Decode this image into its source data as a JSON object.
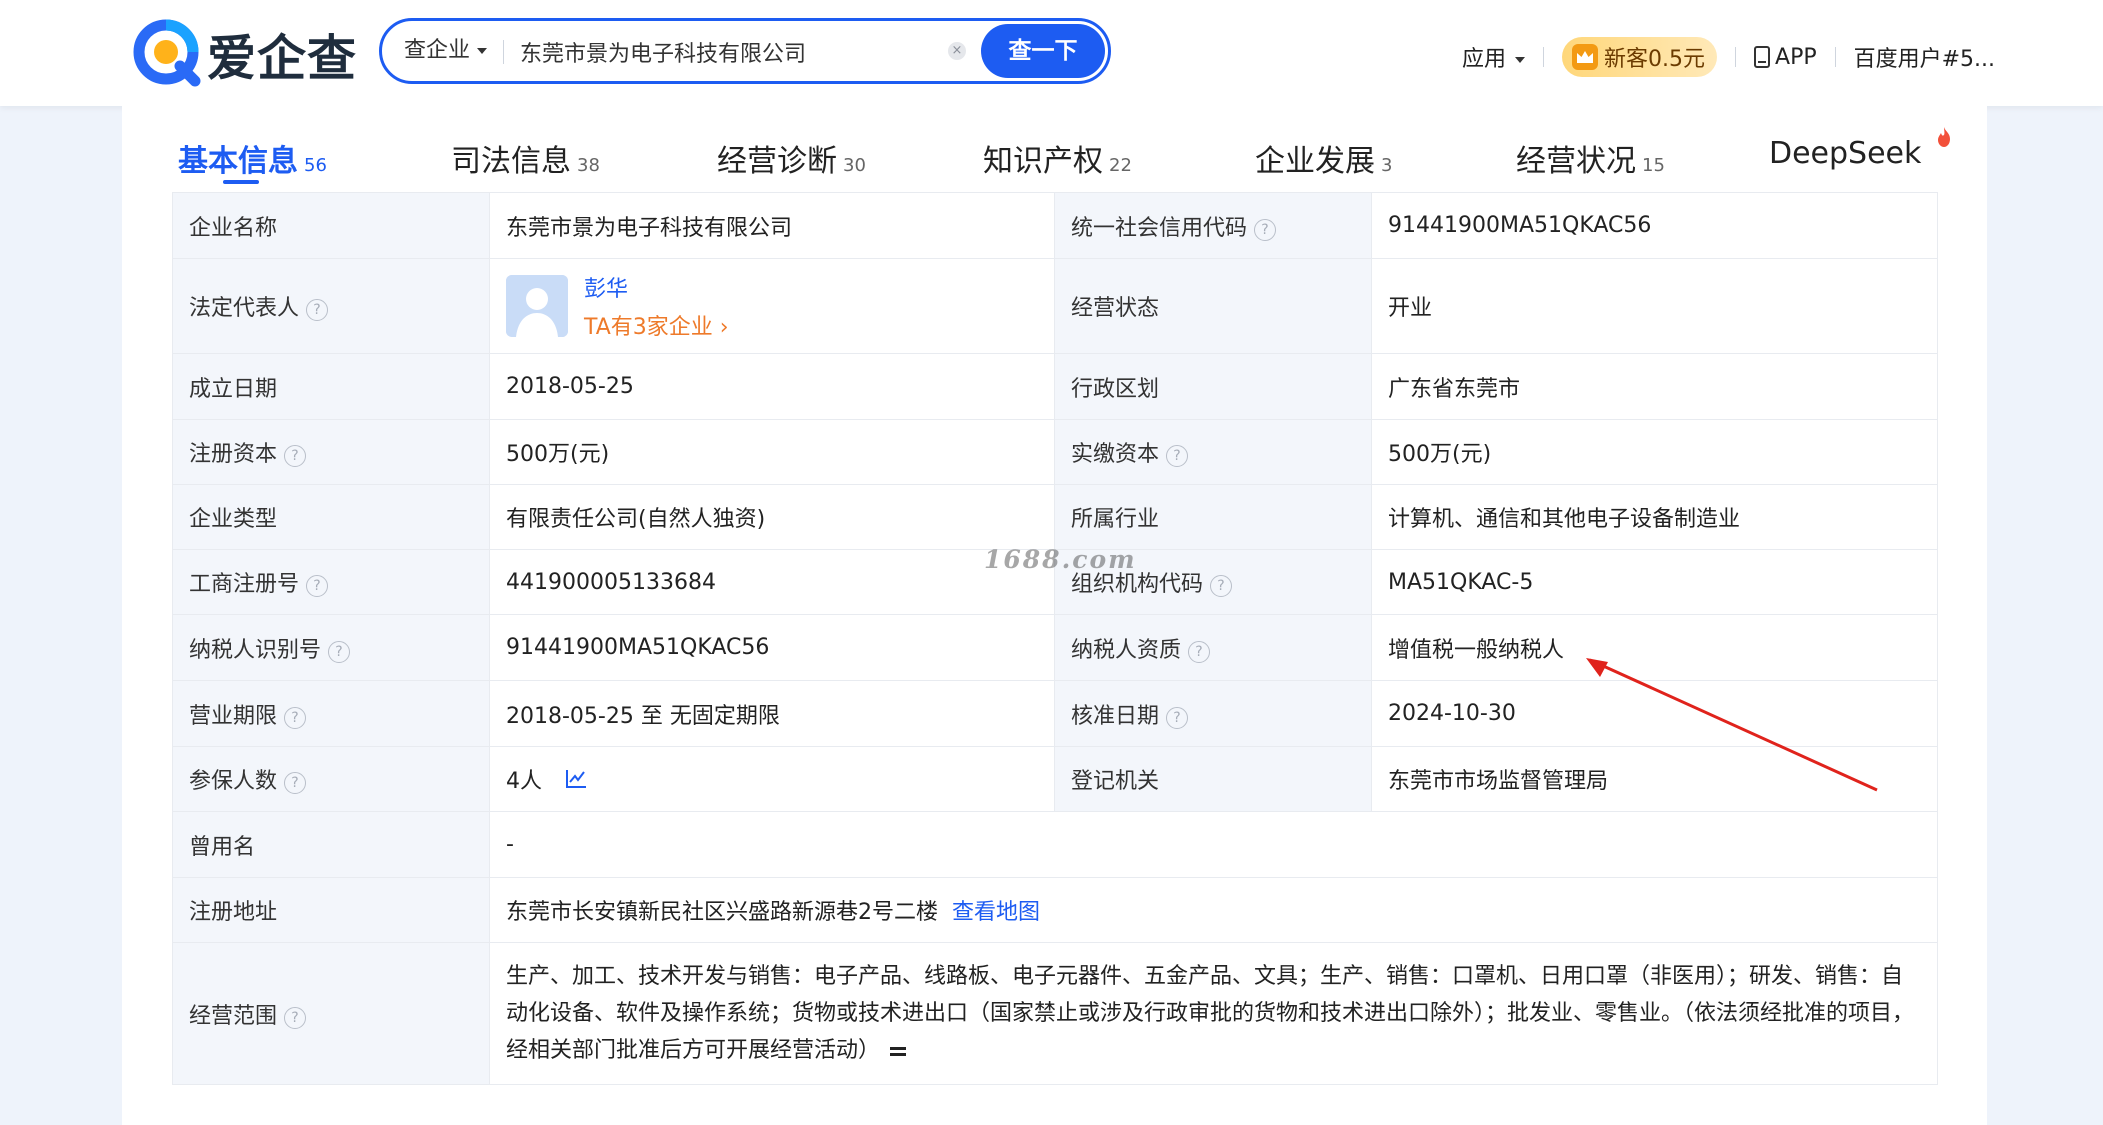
{
  "header": {
    "logo_text": "爱企查",
    "search_type": "查企业",
    "search_value": "东莞市景为电子科技有限公司",
    "search_button": "查一下",
    "nav_app": "应用",
    "vip_badge": "新客0.5元",
    "nav_download": "APP",
    "user_name": "百度用户#5..."
  },
  "tabs": [
    {
      "label": "基本信息",
      "count": "56",
      "active": true
    },
    {
      "label": "司法信息",
      "count": "38"
    },
    {
      "label": "经营诊断",
      "count": "30"
    },
    {
      "label": "知识产权",
      "count": "22"
    },
    {
      "label": "企业发展",
      "count": "3"
    },
    {
      "label": "经营状况",
      "count": "15"
    },
    {
      "label": "DeepSeek",
      "count": ""
    }
  ],
  "info": {
    "company_name_label": "企业名称",
    "company_name": "东莞市景为电子科技有限公司",
    "credit_code_label": "统一社会信用代码",
    "credit_code": "91441900MA51QKAC56",
    "legal_rep_label": "法定代表人",
    "legal_rep_name": "彭华",
    "legal_rep_link": "TA有3家企业",
    "status_label": "经营状态",
    "status": "开业",
    "founded_label": "成立日期",
    "founded": "2018-05-25",
    "region_label": "行政区划",
    "region": "广东省东莞市",
    "reg_capital_label": "注册资本",
    "reg_capital": "500万(元)",
    "paid_capital_label": "实缴资本",
    "paid_capital": "500万(元)",
    "type_label": "企业类型",
    "type": "有限责任公司(自然人独资)",
    "industry_label": "所属行业",
    "industry": "计算机、通信和其他电子设备制造业",
    "reg_no_label": "工商注册号",
    "reg_no": "441900005133684",
    "org_code_label": "组织机构代码",
    "org_code": "MA51QKAC-5",
    "taxpayer_id_label": "纳税人识别号",
    "taxpayer_id": "91441900MA51QKAC56",
    "taxpayer_qual_label": "纳税人资质",
    "taxpayer_qual": "增值税一般纳税人",
    "term_label": "营业期限",
    "term": "2018-05-25 至 无固定期限",
    "approval_date_label": "核准日期",
    "approval_date": "2024-10-30",
    "insured_label": "参保人数",
    "insured": "4人",
    "authority_label": "登记机关",
    "authority": "东莞市市场监督管理局",
    "former_name_label": "曾用名",
    "former_name": "-",
    "address_label": "注册地址",
    "address": "东莞市长安镇新民社区兴盛路新源巷2号二楼",
    "address_link": "查看地图",
    "scope_label": "经营范围",
    "scope": "生产、加工、技术开发与销售：电子产品、线路板、电子元器件、五金产品、文具；生产、销售：口罩机、日用口罩（非医用）；研发、销售：自动化设备、软件及操作系统；货物或技术进出口（国家禁止或涉及行政审批的货物和技术进出口除外）；批发业、零售业。（依法须经批准的项目，经相关部门批准后方可开展经营活动）"
  },
  "watermark": "1688.com",
  "colors": {
    "brand_blue": "#1d5cf2",
    "orange_link": "#ee7a2a",
    "annotation_red": "#e0231c"
  }
}
